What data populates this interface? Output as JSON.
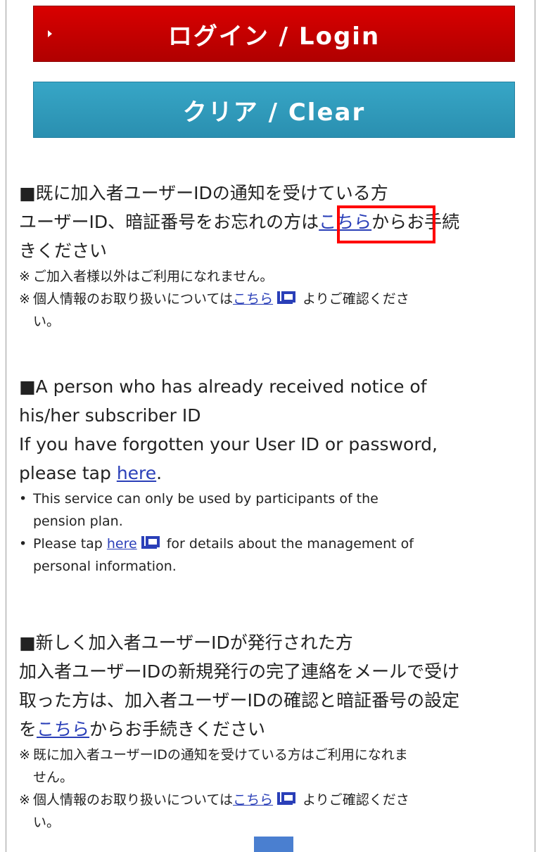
{
  "buttons": {
    "login_label": "ログイン / Login",
    "clear_label": "クリア / Clear"
  },
  "colors": {
    "login_red": "#c80000",
    "clear_blue": "#31a0c0",
    "link_blue": "#2a3fb8",
    "highlight_red": "#ff0000"
  },
  "section_existing_jp": {
    "heading": "■既に加入者ユーザーIDの通知を受けている方",
    "line1_before": "ユーザーID、暗証番号をお忘れの方は",
    "line1_link": "こちら",
    "line1_after": "からお手続",
    "line2": "きください",
    "note1_mark": "※",
    "note1_text": "ご加入者様以外はご利用になれません。",
    "note2_mark": "※",
    "note2_before": "個人情報のお取り扱いについては",
    "note2_link": "こちら",
    "note2_after": "よりご確認くださ",
    "note2_cont": "い。"
  },
  "section_existing_en": {
    "heading": "■A person who has already received notice of",
    "heading_cont": "his/her subscriber ID",
    "line1": "If you have forgotten your User ID or password,",
    "line2_before": "please tap ",
    "line2_link": "here",
    "line2_after": ".",
    "note1_mark": "•",
    "note1_text": "This service can only be used by participants of the",
    "note1_cont": "pension plan.",
    "note2_mark": "•",
    "note2_before": "Please tap ",
    "note2_link": "here",
    "note2_after": "for details about the management of",
    "note2_cont": "personal information."
  },
  "section_new_jp": {
    "heading": "■新しく加入者ユーザーIDが発行された方",
    "line1": "加入者ユーザーIDの新規発行の完了連絡をメールで受け",
    "line2": "取った方は、加入者ユーザーIDの確認と暗証番号の設定",
    "line3_before": "を",
    "line3_link": "こちら",
    "line3_after": "からお手続きください",
    "note1_mark": "※",
    "note1_text": "既に加入者ユーザーIDの通知を受けている方はご利用になれま",
    "note1_cont": "せん。",
    "note2_mark": "※",
    "note2_before": "個人情報のお取り扱いについては",
    "note2_link": "こちら",
    "note2_after": "よりご確認くださ",
    "note2_cont": "い。"
  },
  "icons": {
    "login_caret": "caret-right-icon",
    "external_window": "external-window-icon",
    "page_top": "page-top-button"
  }
}
